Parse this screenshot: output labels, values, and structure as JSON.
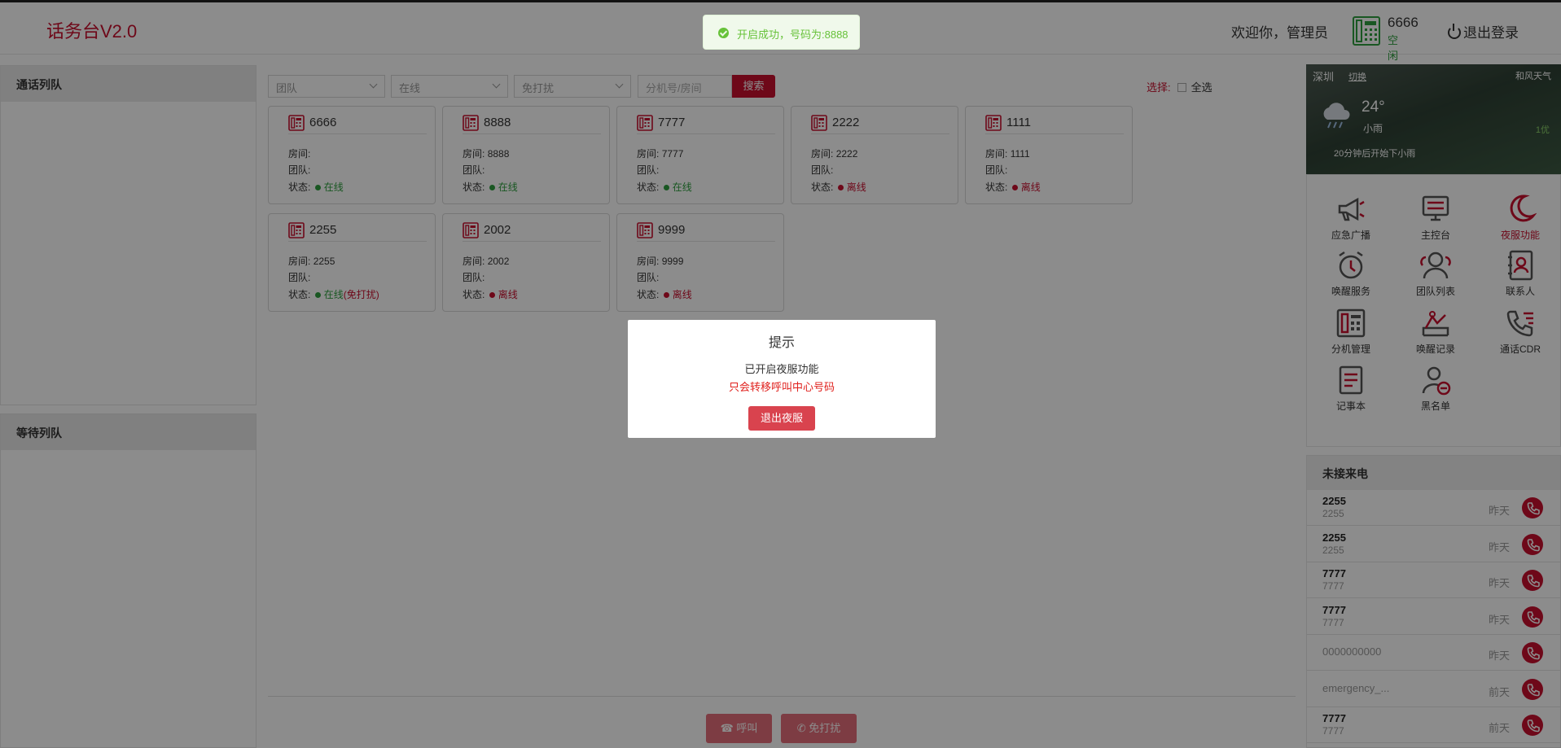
{
  "header": {
    "logo": "话务台V2.0",
    "welcome": "欢迎你，管理员",
    "extension": {
      "number": "6666",
      "status": "空闲"
    },
    "logout": "退出登录"
  },
  "queues": {
    "call_queue_title": "通话列队",
    "wait_queue_title": "等待列队"
  },
  "filters": {
    "team_placeholder": "团队",
    "status_value": "在线",
    "dnd_placeholder": "免打扰",
    "search_placeholder": "分机号/房间",
    "search_button": "搜索",
    "select_label": "选择:",
    "select_all": "全选"
  },
  "labels": {
    "room": "房间:",
    "team": "团队:",
    "status": "状态:"
  },
  "extensions": [
    {
      "number": "6666",
      "room": "",
      "team": "",
      "status": "在线",
      "state": "online",
      "extra": ""
    },
    {
      "number": "8888",
      "room": "8888",
      "team": "",
      "status": "在线",
      "state": "online",
      "extra": ""
    },
    {
      "number": "7777",
      "room": "7777",
      "team": "",
      "status": "在线",
      "state": "online",
      "extra": ""
    },
    {
      "number": "2222",
      "room": "2222",
      "team": "",
      "status": "离线",
      "state": "offline",
      "extra": ""
    },
    {
      "number": "1111",
      "room": "1111",
      "team": "",
      "status": "离线",
      "state": "offline",
      "extra": ""
    },
    {
      "number": "2255",
      "room": "2255",
      "team": "",
      "status": "在线",
      "state": "online",
      "extra": "(免打扰)"
    },
    {
      "number": "2002",
      "room": "2002",
      "team": "",
      "status": "离线",
      "state": "offline",
      "extra": ""
    },
    {
      "number": "9999",
      "room": "9999",
      "team": "",
      "status": "离线",
      "state": "offline",
      "extra": ""
    }
  ],
  "bottom_actions": {
    "call": "呼叫",
    "dnd": "免打扰"
  },
  "weather": {
    "city": "深圳",
    "switch": "切换",
    "brand": "和风天气",
    "temp": "24°",
    "desc": "小雨",
    "aqi": "1优",
    "tip": "20分钟后开始下小雨"
  },
  "functions": [
    {
      "label": "应急广播",
      "icon": "megaphone-icon"
    },
    {
      "label": "主控台",
      "icon": "console-icon"
    },
    {
      "label": "夜服功能",
      "icon": "moon-icon"
    },
    {
      "label": "唤醒服务",
      "icon": "alarm-clock-icon"
    },
    {
      "label": "团队列表",
      "icon": "team-icon"
    },
    {
      "label": "联系人",
      "icon": "contacts-icon"
    },
    {
      "label": "分机管理",
      "icon": "extension-icon"
    },
    {
      "label": "唤醒记录",
      "icon": "wake-record-icon"
    },
    {
      "label": "通话CDR",
      "icon": "call-cdr-icon"
    },
    {
      "label": "记事本",
      "icon": "notepad-icon"
    },
    {
      "label": "黑名单",
      "icon": "blacklist-icon"
    }
  ],
  "missed_calls": {
    "title": "未接来电",
    "items": [
      {
        "name": "2255",
        "number": "2255",
        "time": "昨天"
      },
      {
        "name": "2255",
        "number": "2255",
        "time": "昨天"
      },
      {
        "name": "7777",
        "number": "7777",
        "time": "昨天"
      },
      {
        "name": "7777",
        "number": "7777",
        "time": "昨天"
      },
      {
        "name": "",
        "number": "0000000000",
        "time": "昨天"
      },
      {
        "name": "",
        "number": "emergency_...",
        "time": "前天"
      },
      {
        "name": "7777",
        "number": "7777",
        "time": "前天"
      }
    ]
  },
  "dialog": {
    "title": "提示",
    "line1": "已开启夜服功能",
    "line2": "只会转移呼叫中心号码",
    "button": "退出夜服"
  },
  "toast": {
    "message": "开启成功，号码为:8888"
  },
  "colors": {
    "brand": "#c8102e",
    "online": "#2e9e3e",
    "offline": "#c8102e",
    "toast": "#67c23a"
  }
}
